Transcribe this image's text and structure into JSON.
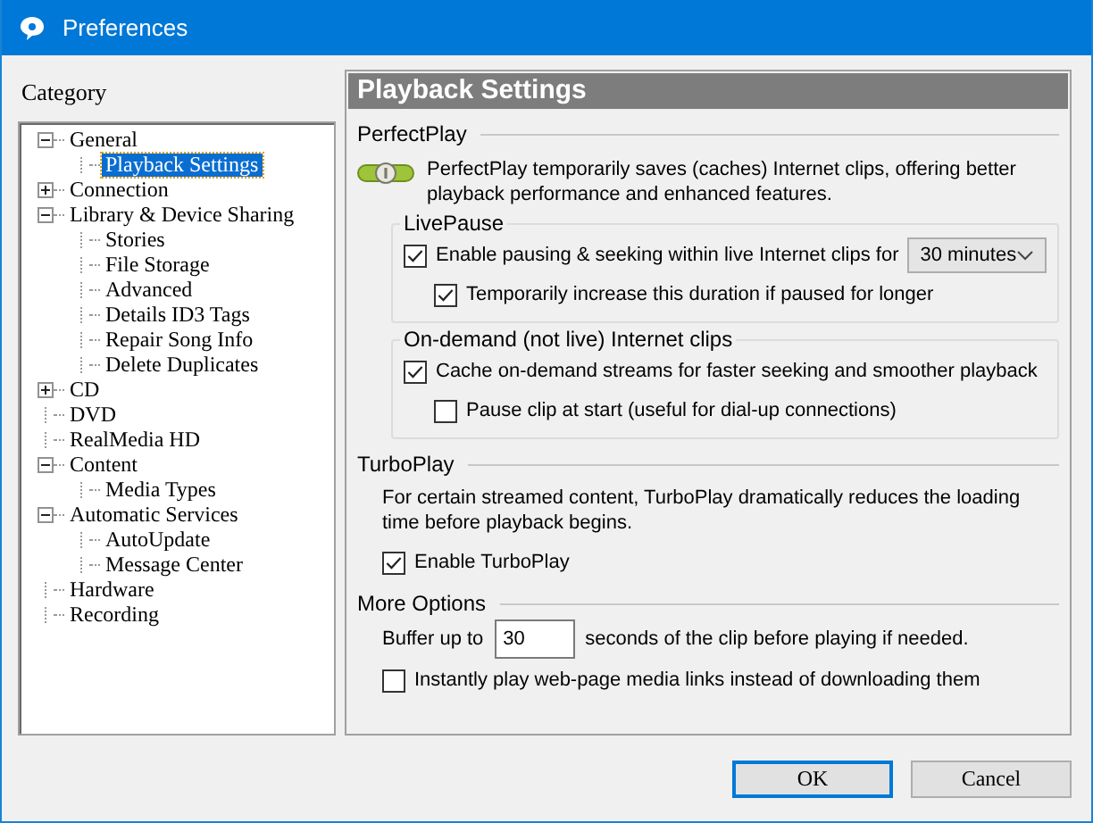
{
  "window": {
    "title": "Preferences"
  },
  "category_label": "Category",
  "tree": [
    {
      "label": "General",
      "expanded": true,
      "selected": false,
      "children": [
        {
          "label": "Playback Settings",
          "selected": true
        }
      ]
    },
    {
      "label": "Connection",
      "expanded": false,
      "selected": false
    },
    {
      "label": "Library & Device Sharing",
      "expanded": true,
      "selected": false,
      "children": [
        {
          "label": "Stories",
          "selected": false
        },
        {
          "label": "File Storage",
          "selected": false
        },
        {
          "label": "Advanced",
          "selected": false
        },
        {
          "label": "Details ID3 Tags",
          "selected": false
        },
        {
          "label": "Repair Song Info",
          "selected": false
        },
        {
          "label": "Delete Duplicates",
          "selected": false
        }
      ]
    },
    {
      "label": "CD",
      "expanded": false,
      "selected": false
    },
    {
      "label": "DVD",
      "selected": false
    },
    {
      "label": "RealMedia HD",
      "selected": false
    },
    {
      "label": "Content",
      "expanded": true,
      "selected": false,
      "children": [
        {
          "label": "Media Types",
          "selected": false
        }
      ]
    },
    {
      "label": "Automatic Services",
      "expanded": true,
      "selected": false,
      "children": [
        {
          "label": "AutoUpdate",
          "selected": false
        },
        {
          "label": "Message Center",
          "selected": false
        }
      ]
    },
    {
      "label": "Hardware",
      "selected": false
    },
    {
      "label": "Recording",
      "selected": false
    }
  ],
  "panel": {
    "title": "Playback Settings",
    "sections": [
      {
        "kind": "with-icon",
        "title": "PerfectPlay",
        "description": "PerfectPlay temporarily saves (caches) Internet clips, offering better playback performance and enhanced features.",
        "groups": [
          {
            "title": "LivePause",
            "options": [
              {
                "kind": "checkbox",
                "label": "Enable pausing & seeking within live Internet clips for",
                "checked": true,
                "dropdown": "30 minutes",
                "children": [
                  {
                    "kind": "checkbox",
                    "label": "Temporarily increase this duration if paused for longer",
                    "checked": true
                  }
                ]
              }
            ]
          },
          {
            "title": "On-demand (not live) Internet clips",
            "options": [
              {
                "kind": "checkbox",
                "label": "Cache on-demand streams for faster seeking and smoother playback",
                "checked": true,
                "children": [
                  {
                    "kind": "checkbox",
                    "label": "Pause clip at start (useful for dial-up connections)",
                    "checked": false
                  }
                ]
              }
            ]
          }
        ]
      },
      {
        "kind": "plain",
        "title": "TurboPlay",
        "description": "For certain streamed content, TurboPlay dramatically reduces the loading time before playback begins.",
        "options": [
          {
            "kind": "checkbox",
            "label": "Enable TurboPlay",
            "checked": true
          }
        ]
      },
      {
        "kind": "plain",
        "title": "More Options",
        "options": [
          {
            "kind": "number",
            "prefix": "Buffer up to",
            "value": "30",
            "suffix": "seconds of the clip before playing if needed."
          },
          {
            "kind": "checkbox",
            "label": "Instantly play web-page media links instead of downloading them",
            "checked": false
          }
        ]
      }
    ]
  },
  "buttons": [
    {
      "label": "OK",
      "default": true
    },
    {
      "label": "Cancel",
      "default": false
    }
  ]
}
